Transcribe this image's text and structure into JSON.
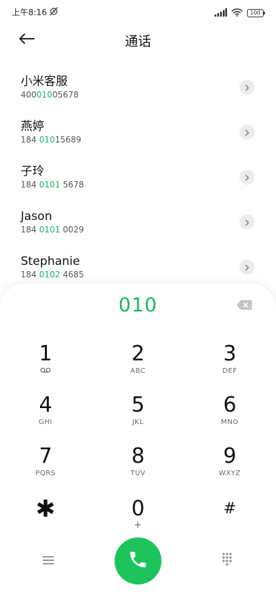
{
  "status_bar": {
    "time": "上午8:16",
    "battery": "100",
    "icons": [
      "alarm-off-icon",
      "signal-icon",
      "wifi-icon",
      "battery-icon"
    ]
  },
  "header": {
    "title": "通话",
    "back_icon": "arrow-left-icon"
  },
  "contacts": [
    {
      "name": "小米客服",
      "number_pre": "400",
      "number_match": "010",
      "number_post": "05678"
    },
    {
      "name": "燕婷",
      "number_pre": "184 ",
      "number_match": "010",
      "number_post": "15689"
    },
    {
      "name": "子玲",
      "number_pre": "184 ",
      "number_match": "0101",
      "number_post": " 5678"
    },
    {
      "name": "Jason",
      "number_pre": "184 ",
      "number_match": "0101",
      "number_post": " 0029"
    },
    {
      "name": "Stephanie",
      "number_pre": "184 ",
      "number_match": "0102",
      "number_post": " 4685"
    }
  ],
  "dialer": {
    "input_value": "010",
    "accent_color": "#1fb461",
    "keys": [
      {
        "digit": "1",
        "sub": "",
        "sub_icon": "voicemail-icon"
      },
      {
        "digit": "2",
        "sub": "ABC"
      },
      {
        "digit": "3",
        "sub": "DEF"
      },
      {
        "digit": "4",
        "sub": "GHI"
      },
      {
        "digit": "5",
        "sub": "JKL"
      },
      {
        "digit": "6",
        "sub": "MNO"
      },
      {
        "digit": "7",
        "sub": "PQRS"
      },
      {
        "digit": "8",
        "sub": "TUV"
      },
      {
        "digit": "9",
        "sub": "WXYZ"
      },
      {
        "digit": "✱",
        "sub": ""
      },
      {
        "digit": "0",
        "sub": "+"
      },
      {
        "digit": "#",
        "sub": ""
      }
    ],
    "bottom": {
      "menu_icon": "menu-icon",
      "call_icon": "phone-icon",
      "keypad_icon": "dialpad-icon"
    }
  }
}
